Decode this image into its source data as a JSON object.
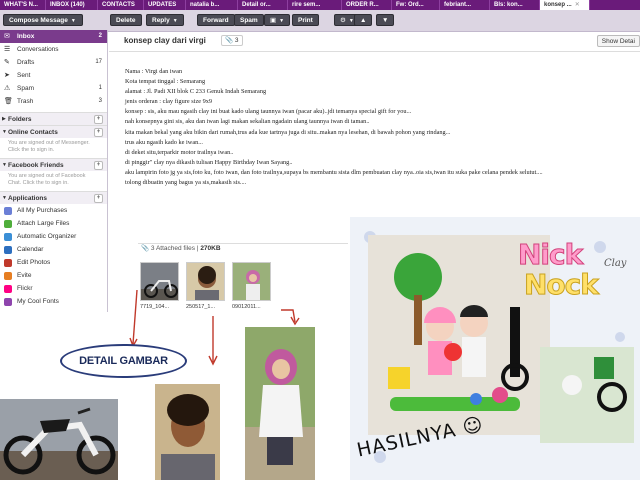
{
  "tabs": [
    {
      "label": "WHAT'S N..."
    },
    {
      "label": "INBOX (140)"
    },
    {
      "label": "CONTACTS"
    },
    {
      "label": "UPDATES"
    },
    {
      "label": "natalia b..."
    },
    {
      "label": "Detail or..."
    },
    {
      "label": "rire sem..."
    },
    {
      "label": "ORDER R..."
    },
    {
      "label": "Fw: Ord..."
    },
    {
      "label": "febriant..."
    },
    {
      "label": "Bls: kon..."
    },
    {
      "label": "konsep ..."
    }
  ],
  "toolbar": {
    "compose": "Compose Message",
    "delete": "Delete",
    "reply": "Reply",
    "forward": "Forward",
    "spam": "Spam",
    "print": "Print"
  },
  "sidebar": {
    "folders": [
      {
        "label": "Inbox",
        "count": "2"
      },
      {
        "label": "Conversations",
        "count": ""
      },
      {
        "label": "Drafts",
        "count": "17"
      },
      {
        "label": "Sent",
        "count": ""
      },
      {
        "label": "Spam",
        "count": "1"
      },
      {
        "label": "Trash",
        "count": "3"
      }
    ],
    "folders_head": "Folders",
    "contacts_head": "Online Contacts",
    "contacts_note": "You are signed out of Messenger. Click the to sign in.",
    "facebook_head": "Facebook Friends",
    "facebook_note": "You are signed out of Facebook Chat. Click the to sign in.",
    "apps_head": "Applications",
    "apps": [
      {
        "label": "All My Purchases",
        "color": "#6b7fd6"
      },
      {
        "label": "Attach Large Files",
        "color": "#4fae3b"
      },
      {
        "label": "Automatic Organizer",
        "color": "#3b8fd6"
      },
      {
        "label": "Calendar",
        "color": "#2d6fbf"
      },
      {
        "label": "Edit Photos",
        "color": "#c0392b"
      },
      {
        "label": "Evite",
        "color": "#e67e22"
      },
      {
        "label": "Flickr",
        "color": "#ff0084"
      },
      {
        "label": "My Cool Fonts",
        "color": "#8e44ad"
      }
    ]
  },
  "message": {
    "subject": "konsep clay dari virgi",
    "attach_count": "3",
    "show_details": "Show Detai",
    "lines": [
      "Nama : Virgi dan iwan",
      "Kota tempat tinggal : Semarang",
      "alamat : Jl. Padi XII blok C 233 Genuk Indah Semarang",
      "jenis orderan : clay figure size 9x9",
      "konsep : sis, aku mau ngasih clay ini buat kado ulang taunnya iwan (pacar aku)..jdi temanya special gift for you...",
      "nah konsepnya gini sis, aku dan iwan lagi makan sekalian ngadain ulang taunnya iwan di taman..",
      "kita makan bekal yang aku bikin dari rumah,trus ada kue tartnya juga di situ..makan nya lesehan, di bawah pohon yang rindang...",
      "trus aku ngasih kado ke iwan...",
      "di deket situ,terparkir motor trailnya iwan..",
      "di pinggir\" clay nya dikasih tulisan Happy Birthday Iwan Sayang..",
      "aku lampirin foto jg ya sis,foto ku, foto iwan, dan foto trailnya,supaya bs membantu sista dlm pembuatan clay nya..oia sis,iwan itu suka pake celana pendek selutut....",
      "tolong dibuatin yang bagus ya sis,makasih sis...."
    ]
  },
  "attachments": {
    "count_label": "3 Attached files",
    "size": "270KB",
    "files": [
      {
        "caption": "7719_104..."
      },
      {
        "caption": "250517_1..."
      },
      {
        "caption": "09012011..."
      }
    ]
  },
  "overlay": {
    "detail_label": "DETAIL GAMBAR",
    "result_label": "HASILNYA",
    "brand_top": "Nick",
    "brand_bottom": "Nock",
    "brand_small": "Clay"
  }
}
